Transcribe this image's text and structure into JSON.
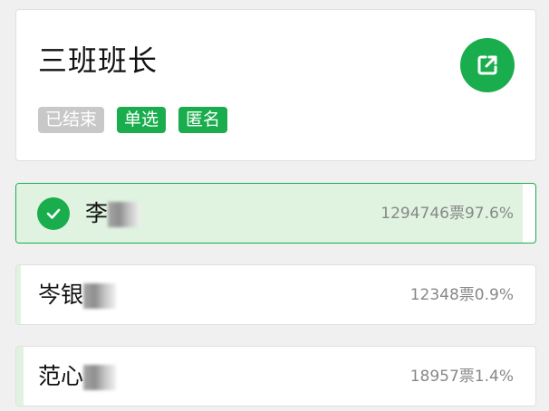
{
  "poll": {
    "title": "三班班长",
    "tags": {
      "status": "已结束",
      "type": "单选",
      "privacy": "匿名"
    }
  },
  "options": [
    {
      "name": "李",
      "votes": "1294746票",
      "percent": "97.6%",
      "fraction": 0.976,
      "selected": true
    },
    {
      "name": "岑银",
      "votes": "12348票",
      "percent": "0.9%",
      "fraction": 0.009,
      "selected": false
    },
    {
      "name": "范心",
      "votes": "18957票",
      "percent": "1.4%",
      "fraction": 0.014,
      "selected": false
    }
  ],
  "colors": {
    "accent": "#1aad4d",
    "fill": "#dff3e0",
    "ended_tag": "#c8c8c8",
    "background": "#f0f0f0"
  },
  "icons": {
    "share": "share-external-icon",
    "check": "check-icon"
  }
}
